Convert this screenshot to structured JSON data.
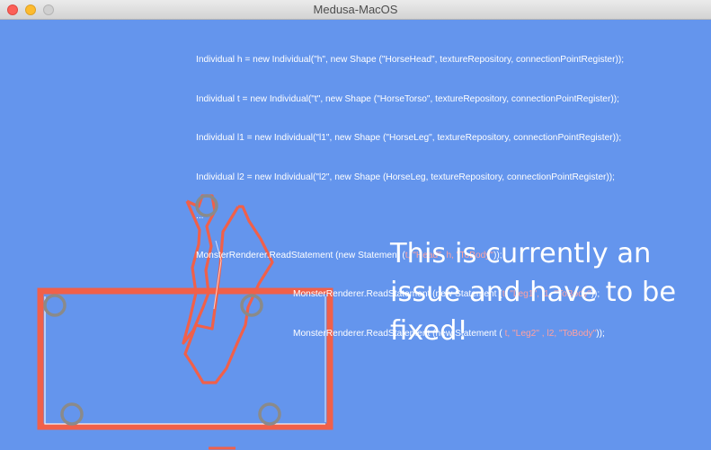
{
  "window": {
    "title": "Medusa-MacOS",
    "buttons": [
      "close",
      "minimize",
      "zoom"
    ]
  },
  "code": {
    "lines": [
      "Individual h = new Individual(\"h\", new Shape (\"HorseHead\", textureRepository, connectionPointRegister));",
      "Individual t = new Individual(\"t\", new Shape (\"HorseTorso\", textureRepository, connectionPointRegister));",
      "Individual l1 = new Individual(\"l1\", new Shape (\"HorseLeg\", textureRepository, connectionPointRegister));",
      "Individual l2 = new Individual(\"l2\", new Shape (HorseLeg, textureRepository, connectionPointRegister));",
      "..."
    ],
    "statements": [
      {
        "prefix": "MonsterRenderer.ReadStatement (new Statement (",
        "args": "t, \"Head\", h, \"ToBody\"",
        "suffix": "));"
      },
      {
        "prefix": "MonsterRenderer.ReadStatement (new Statement (",
        "args": "t, \"Leg1\", l1, \"ToBody\"",
        "suffix": "));"
      },
      {
        "prefix": "MonsterRenderer.ReadStatement (new Statement (",
        "args": " t, \"Leg2\" , l2, \"ToBody\"",
        "suffix": "));"
      }
    ]
  },
  "message": {
    "text": "This is currently an issue and have to be fixed!"
  },
  "colors": {
    "canvas_bg": "#6495ed",
    "shape_stroke": "#f0604a",
    "connection_point": "#8a8a8a",
    "code_text": "#ffffff",
    "code_highlight": "#ffa1a1"
  },
  "scene": {
    "shapes": [
      "horse-torso-outline",
      "horse-head-outline",
      "horse-leg-outline"
    ],
    "connection_points": 5
  }
}
